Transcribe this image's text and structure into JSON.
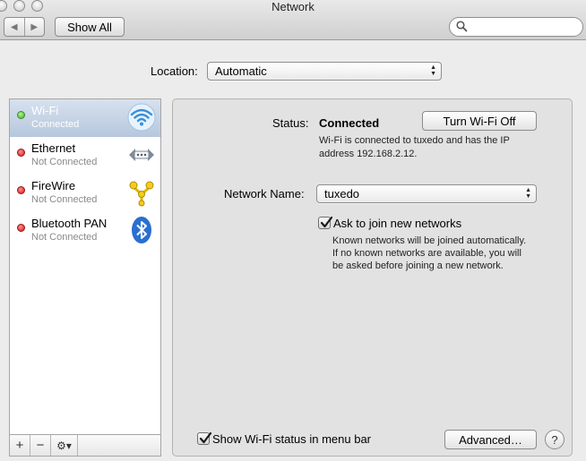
{
  "window": {
    "title": "Network"
  },
  "toolbar": {
    "back_label": "◀",
    "forward_label": "▶",
    "show_all_label": "Show All",
    "search_placeholder": ""
  },
  "location": {
    "label": "Location:",
    "value": "Automatic"
  },
  "services": [
    {
      "name": "Wi-Fi",
      "status": "Connected",
      "status_color": "green",
      "icon": "wifi-icon",
      "selected": true
    },
    {
      "name": "Ethernet",
      "status": "Not Connected",
      "status_color": "red",
      "icon": "ethernet-icon",
      "selected": false
    },
    {
      "name": "FireWire",
      "status": "Not Connected",
      "status_color": "red",
      "icon": "firewire-icon",
      "selected": false
    },
    {
      "name": "Bluetooth PAN",
      "status": "Not Connected",
      "status_color": "red",
      "icon": "bluetooth-icon",
      "selected": false
    }
  ],
  "sidebar_tools": {
    "add": "+",
    "remove": "−",
    "gear": "⚙▾"
  },
  "detail": {
    "status_label": "Status:",
    "status_value": "Connected",
    "turn_off_label": "Turn Wi-Fi Off",
    "status_desc_line1": "Wi-Fi is connected to tuxedo and has the IP",
    "status_desc_line2": "address 192.168.2.12.",
    "network_name_label": "Network Name:",
    "network_name_value": "tuxedo",
    "ask_join_label": "Ask to join new networks",
    "ask_join_checked": true,
    "ask_desc_line1": "Known networks will be joined automatically.",
    "ask_desc_line2": "If no known networks are available, you will",
    "ask_desc_line3": "be asked before joining a new network."
  },
  "footer": {
    "show_status_label": "Show Wi-Fi status in menu bar",
    "show_status_checked": true,
    "advanced_label": "Advanced…",
    "help_label": "?"
  },
  "colors": {
    "selection": "#b7c7dc",
    "status_green": "#3fae1e",
    "status_red": "#d01818",
    "wifi_blue": "#3a8fd8"
  }
}
